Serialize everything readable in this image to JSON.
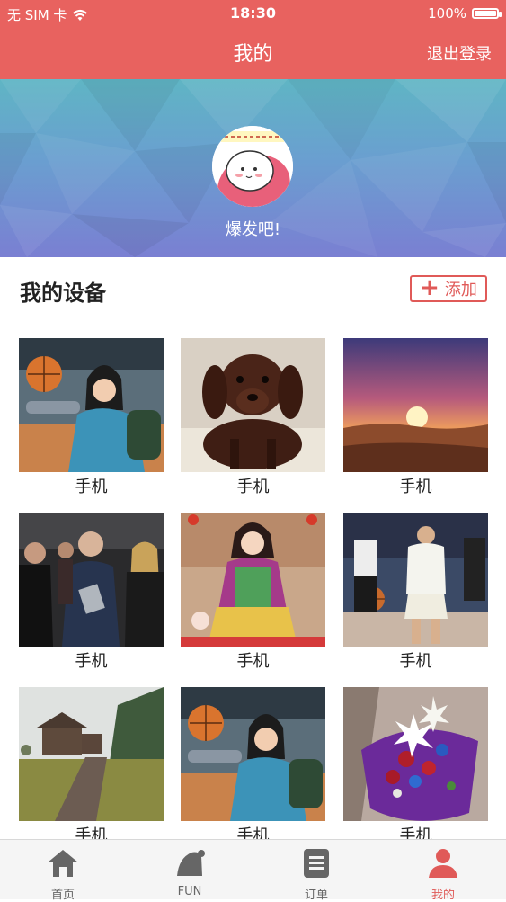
{
  "status_bar": {
    "carrier": "无 SIM 卡",
    "time": "18:30",
    "battery": "100%",
    "battery_level": 1.0
  },
  "header": {
    "title": "我的",
    "logout_label": "退出登录"
  },
  "profile": {
    "nickname": "爆发吧!"
  },
  "devices": {
    "section_title": "我的设备",
    "add_label": "添加",
    "items": [
      {
        "label": "手机",
        "image": "girl-with-basketball"
      },
      {
        "label": "手机",
        "image": "dachshund-dog"
      },
      {
        "label": "手机",
        "image": "sunset"
      },
      {
        "label": "手机",
        "image": "man-with-tablet-crowd"
      },
      {
        "label": "手机",
        "image": "girl-in-costume"
      },
      {
        "label": "手机",
        "image": "basketball-player"
      },
      {
        "label": "手机",
        "image": "cabin-boardwalk"
      },
      {
        "label": "手机",
        "image": "girl-with-basketball"
      },
      {
        "label": "手机",
        "image": "flower-bouquet"
      }
    ]
  },
  "tabbar": {
    "tabs": [
      {
        "label": "首页",
        "icon": "home-icon"
      },
      {
        "label": "FUN",
        "icon": "hat-icon"
      },
      {
        "label": "订单",
        "icon": "orders-icon"
      },
      {
        "label": "我的",
        "icon": "user-icon",
        "active": true
      }
    ]
  },
  "colors": {
    "accent": "#e8625f",
    "active_tab": "#e05a58"
  }
}
